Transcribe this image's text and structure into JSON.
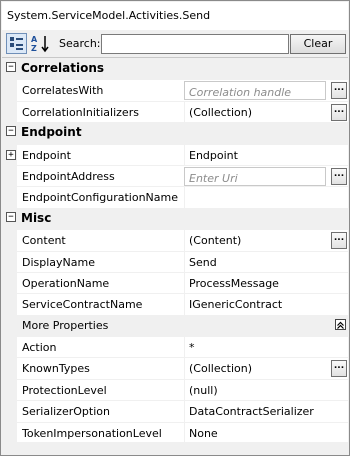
{
  "title": "System.ServiceModel.Activities.Send",
  "toolbar": {
    "search_label": "Search:",
    "search_value": "",
    "clear_label": "Clear"
  },
  "categories": [
    {
      "label": "Correlations",
      "toggle": "−",
      "props": [
        {
          "name": "CorrelatesWith",
          "value": "Correlation handle",
          "placeholder": true,
          "ellipsis": "..."
        },
        {
          "name": "CorrelationInitializers",
          "value": "(Collection)",
          "ellipsis": "..."
        }
      ]
    },
    {
      "label": "Endpoint",
      "toggle": "−",
      "props": [
        {
          "name": "Endpoint",
          "value": "Endpoint",
          "expander": "+"
        },
        {
          "name": "EndpointAddress",
          "value": "Enter Uri",
          "placeholder": true,
          "ellipsis": "..."
        },
        {
          "name": "EndpointConfigurationName",
          "value": ""
        }
      ]
    },
    {
      "label": "Misc",
      "toggle": "−",
      "props": [
        {
          "name": "Content",
          "value": "(Content)",
          "ellipsis": "..."
        },
        {
          "name": "DisplayName",
          "value": "Send"
        },
        {
          "name": "OperationName",
          "value": "ProcessMessage"
        },
        {
          "name": "ServiceContractName",
          "value": "IGenericContract"
        }
      ]
    }
  ],
  "more": {
    "label": "More Properties",
    "props": [
      {
        "name": "Action",
        "value": "*"
      },
      {
        "name": "KnownTypes",
        "value": "(Collection)",
        "ellipsis": "..."
      },
      {
        "name": "ProtectionLevel",
        "value": "(null)"
      },
      {
        "name": "SerializerOption",
        "value": "DataContractSerializer"
      },
      {
        "name": "TokenImpersonationLevel",
        "value": "None"
      }
    ]
  },
  "icons": {
    "categorized": "categorized-view-icon",
    "alphabetical": "sort-alphabetical-icon",
    "collapse": "collapse-up-icon"
  }
}
